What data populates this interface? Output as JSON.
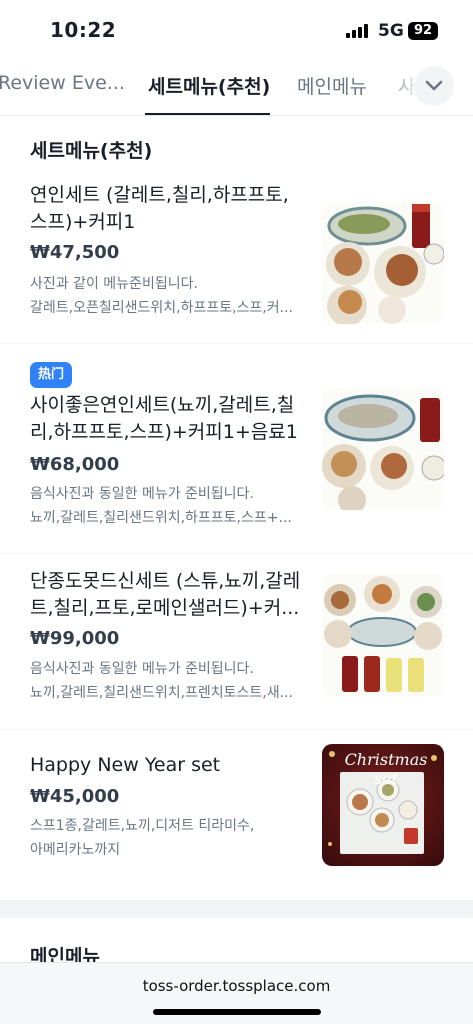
{
  "status": {
    "time": "10:22",
    "network": "5G",
    "battery": "92"
  },
  "tabs": [
    {
      "label": "Review Eve..."
    },
    {
      "label": "세트메뉴(추천)"
    },
    {
      "label": "메인메뉴"
    },
    {
      "label": "사"
    }
  ],
  "section": {
    "title": "세트메뉴(추천)"
  },
  "items": [
    {
      "name": "연인세트 (갈레트,칠리,하프프토,스프)+커피1",
      "price": "₩47,500",
      "desc1": "사진과 같이 메뉴준비됩니다.",
      "desc2": "갈레트,오픈칠리샌드위치,하프프토,스프,커..."
    },
    {
      "badge": "热门",
      "name": "사이좋은연인세트(뇨끼,갈레트,칠리,하프프토,스프)+커피1+음료1",
      "price": "₩68,000",
      "desc1": "음식사진과 동일한 메뉴가 준비됩니다.",
      "desc2": "뇨끼,갈레트,칠리샌드위치,하프프토,스프+..."
    },
    {
      "name": "단종도못드신세트 (스튜,뇨끼,갈레트,칠리,프토,로메인샐러드)+커...",
      "price": "₩99,000",
      "desc1": "음식사진과 동일한 메뉴가 준비됩니다.",
      "desc2": "뇨끼,갈레트,칠리샌드위치,프렌치토스트,새..."
    },
    {
      "name": "Happy New Year set",
      "price": "₩45,000",
      "desc1": "스프1종,갈레트,뇨끼,디저트 티라미수,",
      "desc2": "아메리카노까지",
      "image_text": "Christmas set"
    }
  ],
  "next_section": {
    "title": "메인메뉴"
  },
  "url": "toss-order.tossplace.com"
}
